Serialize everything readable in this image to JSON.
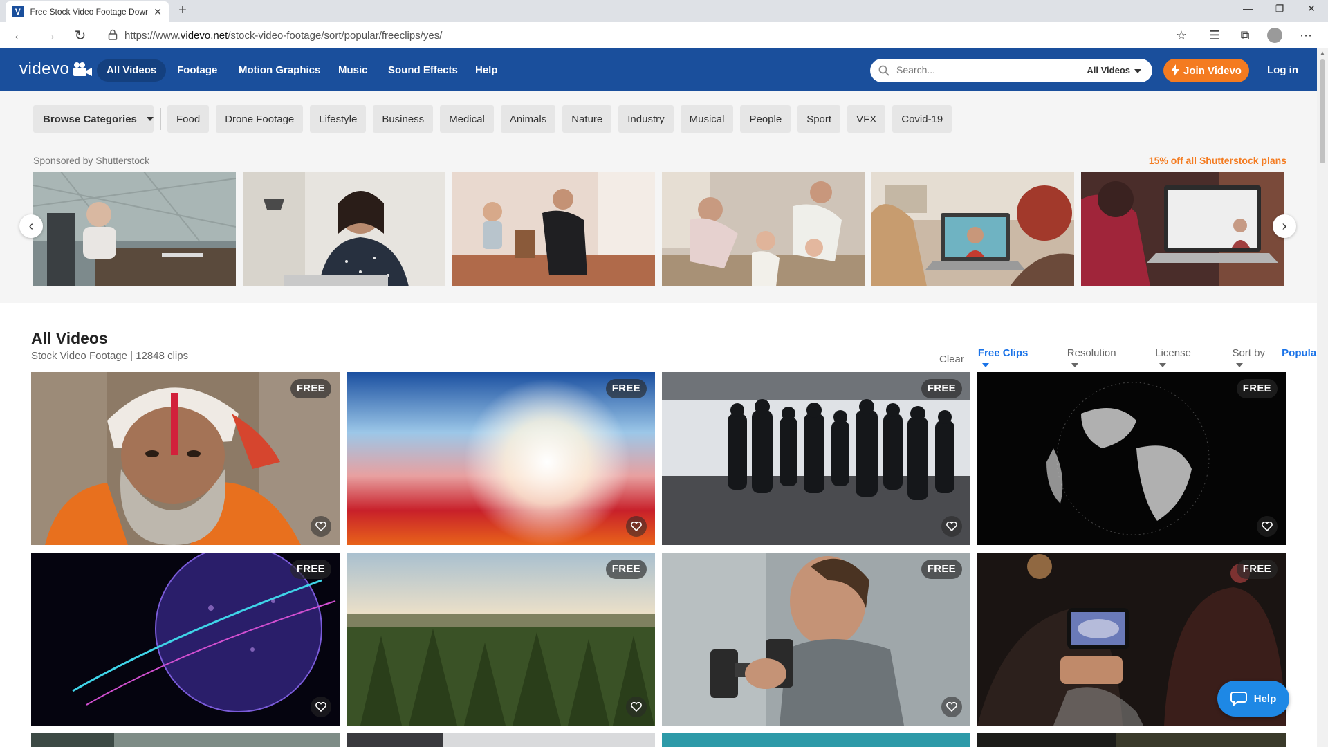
{
  "browser": {
    "tab_title": "Free Stock Video Footage Downl",
    "favicon_letter": "V",
    "url_prefix": "https://www.",
    "url_domain": "videvo.net",
    "url_path": "/stock-video-footage/sort/popular/freeclips/yes/"
  },
  "header": {
    "logo": "videvo",
    "nav": [
      "All Videos",
      "Footage",
      "Motion Graphics",
      "Music",
      "Sound Effects",
      "Help"
    ],
    "search_placeholder": "Search...",
    "search_scope": "All Videos",
    "join_label": "Join Videvo",
    "login_label": "Log in"
  },
  "categories": {
    "browse_label": "Browse Categories",
    "chips": [
      "Food",
      "Drone Footage",
      "Lifestyle",
      "Business",
      "Medical",
      "Animals",
      "Nature",
      "Industry",
      "Musical",
      "People",
      "Sport",
      "VFX",
      "Covid-19"
    ]
  },
  "sponsor": {
    "label": "Sponsored by Shutterstock",
    "promo": "15% off all Shutterstock plans"
  },
  "videos": {
    "title": "All Videos",
    "subtitle": "Stock Video Footage | 12848 clips",
    "filters": {
      "clear": "Clear",
      "free_clips": "Free Clips",
      "resolution": "Resolution",
      "license": "License",
      "sort_by": "Sort by",
      "sort_value": "Popular"
    },
    "badge": "FREE",
    "cards": [
      {
        "subject": "sadhu-portrait"
      },
      {
        "subject": "light-flare"
      },
      {
        "subject": "crowd-silhouettes"
      },
      {
        "subject": "dot-globe"
      },
      {
        "subject": "digital-globe"
      },
      {
        "subject": "forest-aerial"
      },
      {
        "subject": "woman-dumbbell"
      },
      {
        "subject": "phone-recording"
      }
    ]
  },
  "help_label": "Help",
  "colors": {
    "brand_blue": "#1a4f9c",
    "accent_orange": "#f47b20",
    "link_blue": "#1a73e8"
  }
}
